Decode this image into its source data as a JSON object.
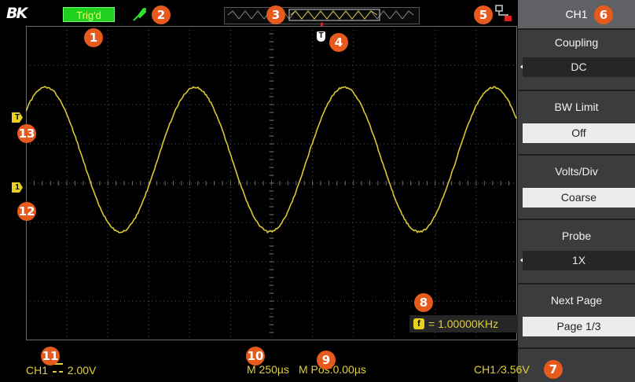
{
  "brand": {
    "logo": "BK"
  },
  "status": {
    "trigger_state": "Trig'd"
  },
  "menu": {
    "title": "CH1",
    "items": [
      {
        "label": "Coupling",
        "value": "DC"
      },
      {
        "label": "BW Limit",
        "value": "Off"
      },
      {
        "label": "Volts/Div",
        "value": "Coarse"
      },
      {
        "label": "Probe",
        "value": "1X"
      },
      {
        "label": "Next Page",
        "value": "Page 1/3"
      }
    ]
  },
  "readouts": {
    "ch1_scale": "CH1",
    "ch1_volts": "2.00V",
    "time_base": "M 250µs",
    "main_position": "M Pos:0.00µs",
    "trigger": "CH1",
    "trigger_level": "3.56V",
    "frequency": "= 1.00000KHz"
  },
  "markers": {
    "trigger_level": "T",
    "ch1_ground": "1",
    "trigger_position": "T",
    "freq_icon": "f"
  },
  "callouts": [
    "1",
    "2",
    "3",
    "4",
    "5",
    "6",
    "7",
    "8",
    "9",
    "10",
    "11",
    "12",
    "13"
  ],
  "colors": {
    "trace": "#d8c832",
    "readout": "#e0cf3c",
    "trig_status_bg": "#1fd01f",
    "callout": "#e65a1e",
    "menu_bg": "#3a3c3e"
  }
}
